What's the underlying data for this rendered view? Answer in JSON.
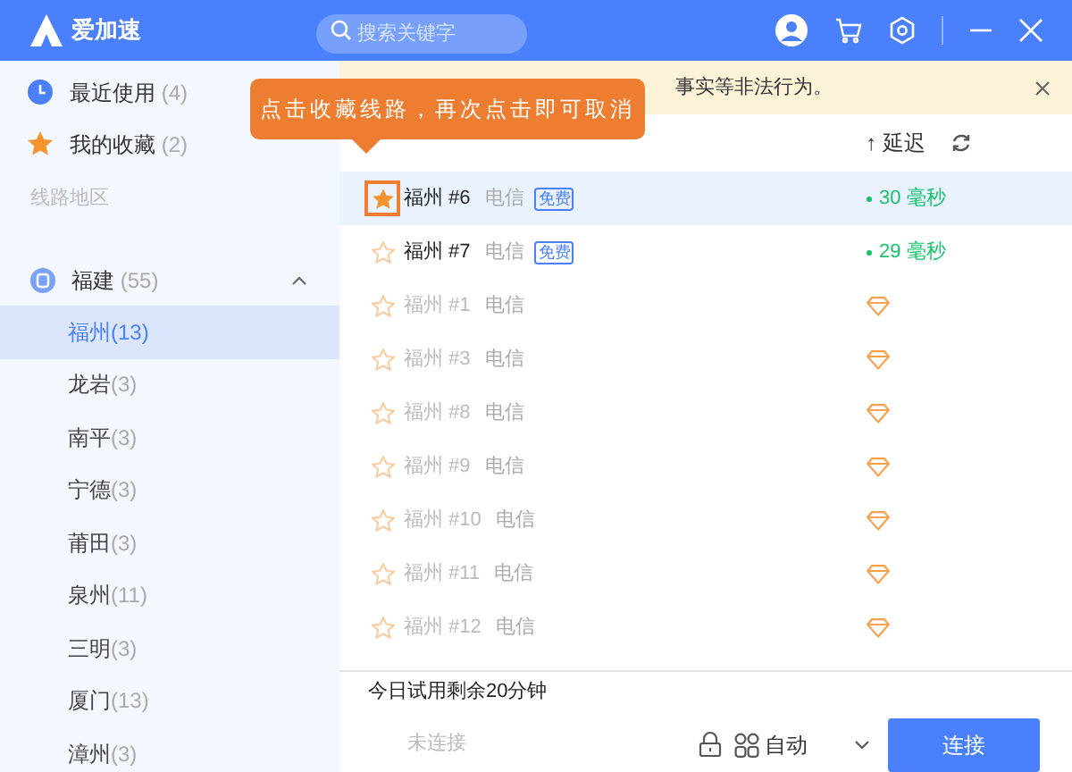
{
  "app": {
    "title": "爱加速",
    "search": {
      "placeholder": "搜索关键字"
    }
  },
  "sidebar": {
    "items": [
      {
        "label": "最近使用",
        "count": "(4)",
        "kind": "recent"
      },
      {
        "label": "我的收藏",
        "count": "(2)",
        "kind": "favorites"
      }
    ],
    "section_title": "线路地区",
    "provinces": [
      {
        "label": "福建",
        "count": "(55)",
        "expanded": true,
        "children": [
          {
            "label": "福州",
            "count": "(13)",
            "selected": true
          },
          {
            "label": "龙岩",
            "count": "(3)",
            "selected": false
          },
          {
            "label": "南平",
            "count": "(3)",
            "selected": false
          },
          {
            "label": "宁德",
            "count": "(3)",
            "selected": false
          },
          {
            "label": "莆田",
            "count": "(3)",
            "selected": false
          },
          {
            "label": "泉州",
            "count": "(11)",
            "selected": false
          },
          {
            "label": "三明",
            "count": "(3)",
            "selected": false
          },
          {
            "label": "厦门",
            "count": "(13)",
            "selected": false
          },
          {
            "label": "漳州",
            "count": "(3)",
            "selected": false
          }
        ]
      }
    ]
  },
  "notice": {
    "text": "事实等非法行为。"
  },
  "tooltip": {
    "text": "点击收藏线路，再次点击即可取消"
  },
  "table": {
    "latency_header": "↑ 延迟",
    "rows": [
      {
        "name": "福州 #6",
        "isp": "电信",
        "badge": "免费",
        "kind": "latency",
        "latency": "30 毫秒",
        "favorite": true,
        "selected": true,
        "disabled": false
      },
      {
        "name": "福州 #7",
        "isp": "电信",
        "badge": "免费",
        "kind": "latency",
        "latency": "29 毫秒",
        "favorite": false,
        "selected": false,
        "disabled": false
      },
      {
        "name": "福州 #1",
        "isp": "电信",
        "kind": "vip",
        "favorite": false,
        "selected": false,
        "disabled": true
      },
      {
        "name": "福州 #3",
        "isp": "电信",
        "kind": "vip",
        "favorite": false,
        "selected": false,
        "disabled": true
      },
      {
        "name": "福州 #8",
        "isp": "电信",
        "kind": "vip",
        "favorite": false,
        "selected": false,
        "disabled": true
      },
      {
        "name": "福州 #9",
        "isp": "电信",
        "kind": "vip",
        "favorite": false,
        "selected": false,
        "disabled": true
      },
      {
        "name": "福州 #10",
        "isp": "电信",
        "kind": "vip",
        "favorite": false,
        "selected": false,
        "disabled": true
      },
      {
        "name": "福州 #11",
        "isp": "电信",
        "kind": "vip",
        "favorite": false,
        "selected": false,
        "disabled": true
      },
      {
        "name": "福州 #12",
        "isp": "电信",
        "kind": "vip",
        "favorite": false,
        "selected": false,
        "disabled": true
      }
    ]
  },
  "footer": {
    "trial": "今日试用剩余20分钟",
    "status": "未连接",
    "mode": "自动",
    "connect": "连接"
  }
}
